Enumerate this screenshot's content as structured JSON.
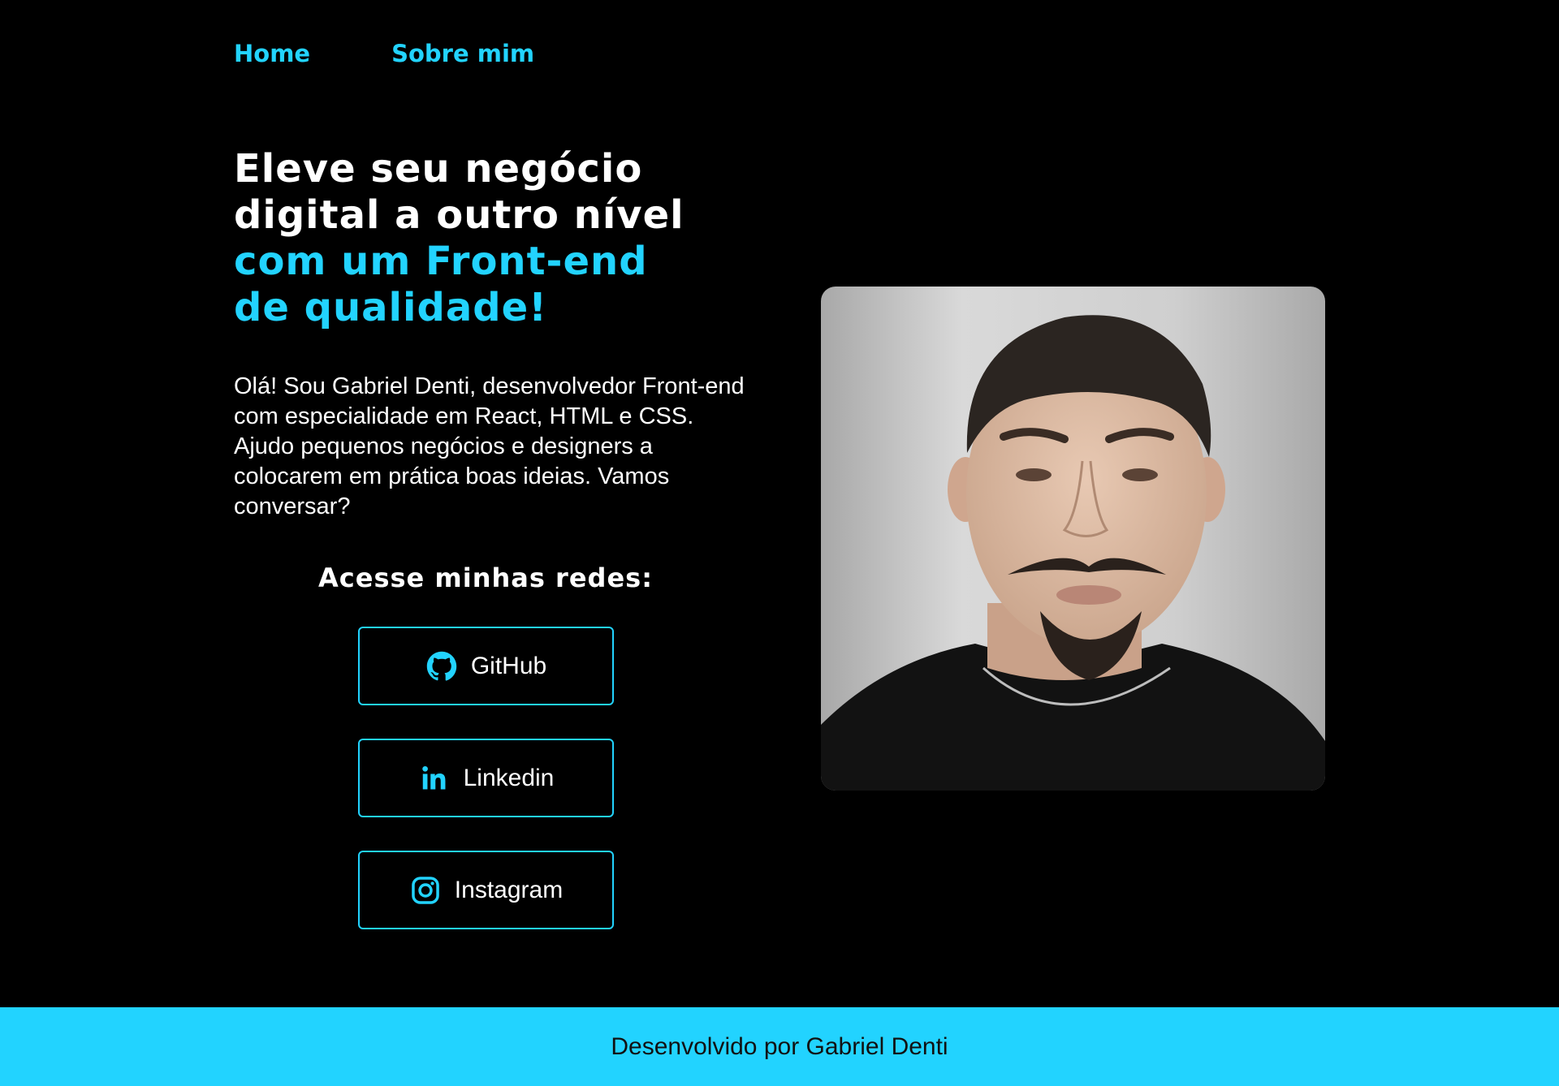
{
  "nav": {
    "items": [
      {
        "label": "Home"
      },
      {
        "label": "Sobre mim"
      }
    ]
  },
  "hero": {
    "headline_lines": [
      "Eleve seu negócio",
      "digital a outro nível",
      "com um Front-end",
      "de qualidade!"
    ],
    "intro": "Olá! Sou Gabriel Denti, desenvolvedor Front-end com especialidade em React, HTML e CSS. Ajudo pequenos negócios e designers a colocarem em prática boas ideias. Vamos conversar?",
    "networks_title": "Acesse minhas redes:"
  },
  "social": {
    "items": [
      {
        "label": "GitHub",
        "icon": "github-icon"
      },
      {
        "label": "Linkedin",
        "icon": "linkedin-icon"
      },
      {
        "label": "Instagram",
        "icon": "instagram-icon"
      }
    ]
  },
  "footer": {
    "text": "Desenvolvido por Gabriel Denti"
  },
  "colors": {
    "background": "#000000",
    "accent": "#22d3ff",
    "text": "#ffffff",
    "footer_text": "#111111"
  }
}
